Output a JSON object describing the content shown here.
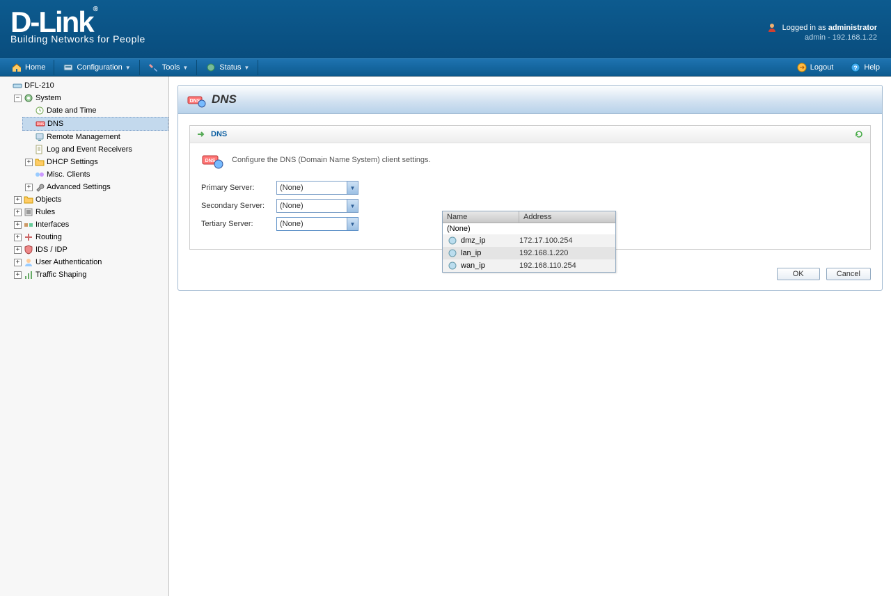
{
  "brand": {
    "name": "D-Link",
    "tagline": "Building Networks for People"
  },
  "login": {
    "prefix": "Logged in as ",
    "user": "administrator",
    "sub": "admin - 192.168.1.22"
  },
  "menu": {
    "home": "Home",
    "configuration": "Configuration",
    "tools": "Tools",
    "status": "Status",
    "logout": "Logout",
    "help": "Help"
  },
  "tree": {
    "root": "DFL-210",
    "system": "System",
    "date_time": "Date and Time",
    "dns": "DNS",
    "remote_mgmt": "Remote Management",
    "log_evt": "Log and Event Receivers",
    "dhcp": "DHCP Settings",
    "misc": "Misc. Clients",
    "advanced": "Advanced Settings",
    "objects": "Objects",
    "rules": "Rules",
    "interfaces": "Interfaces",
    "routing": "Routing",
    "ids": "IDS / IDP",
    "user_auth": "User Authentication",
    "traffic": "Traffic Shaping"
  },
  "page": {
    "title": "DNS",
    "section_title": "DNS",
    "desc": "Configure the DNS (Domain Name System) client settings.",
    "primary_label": "Primary Server:",
    "secondary_label": "Secondary Server:",
    "tertiary_label": "Tertiary Server:",
    "primary_value": "(None)",
    "secondary_value": "(None)",
    "tertiary_value": "(None)",
    "ok": "OK",
    "cancel": "Cancel"
  },
  "dropdown": {
    "col_name": "Name",
    "col_addr": "Address",
    "none": "(None)",
    "rows": [
      {
        "name": "dmz_ip",
        "addr": "172.17.100.254"
      },
      {
        "name": "lan_ip",
        "addr": "192.168.1.220"
      },
      {
        "name": "wan_ip",
        "addr": "192.168.110.254"
      }
    ]
  }
}
